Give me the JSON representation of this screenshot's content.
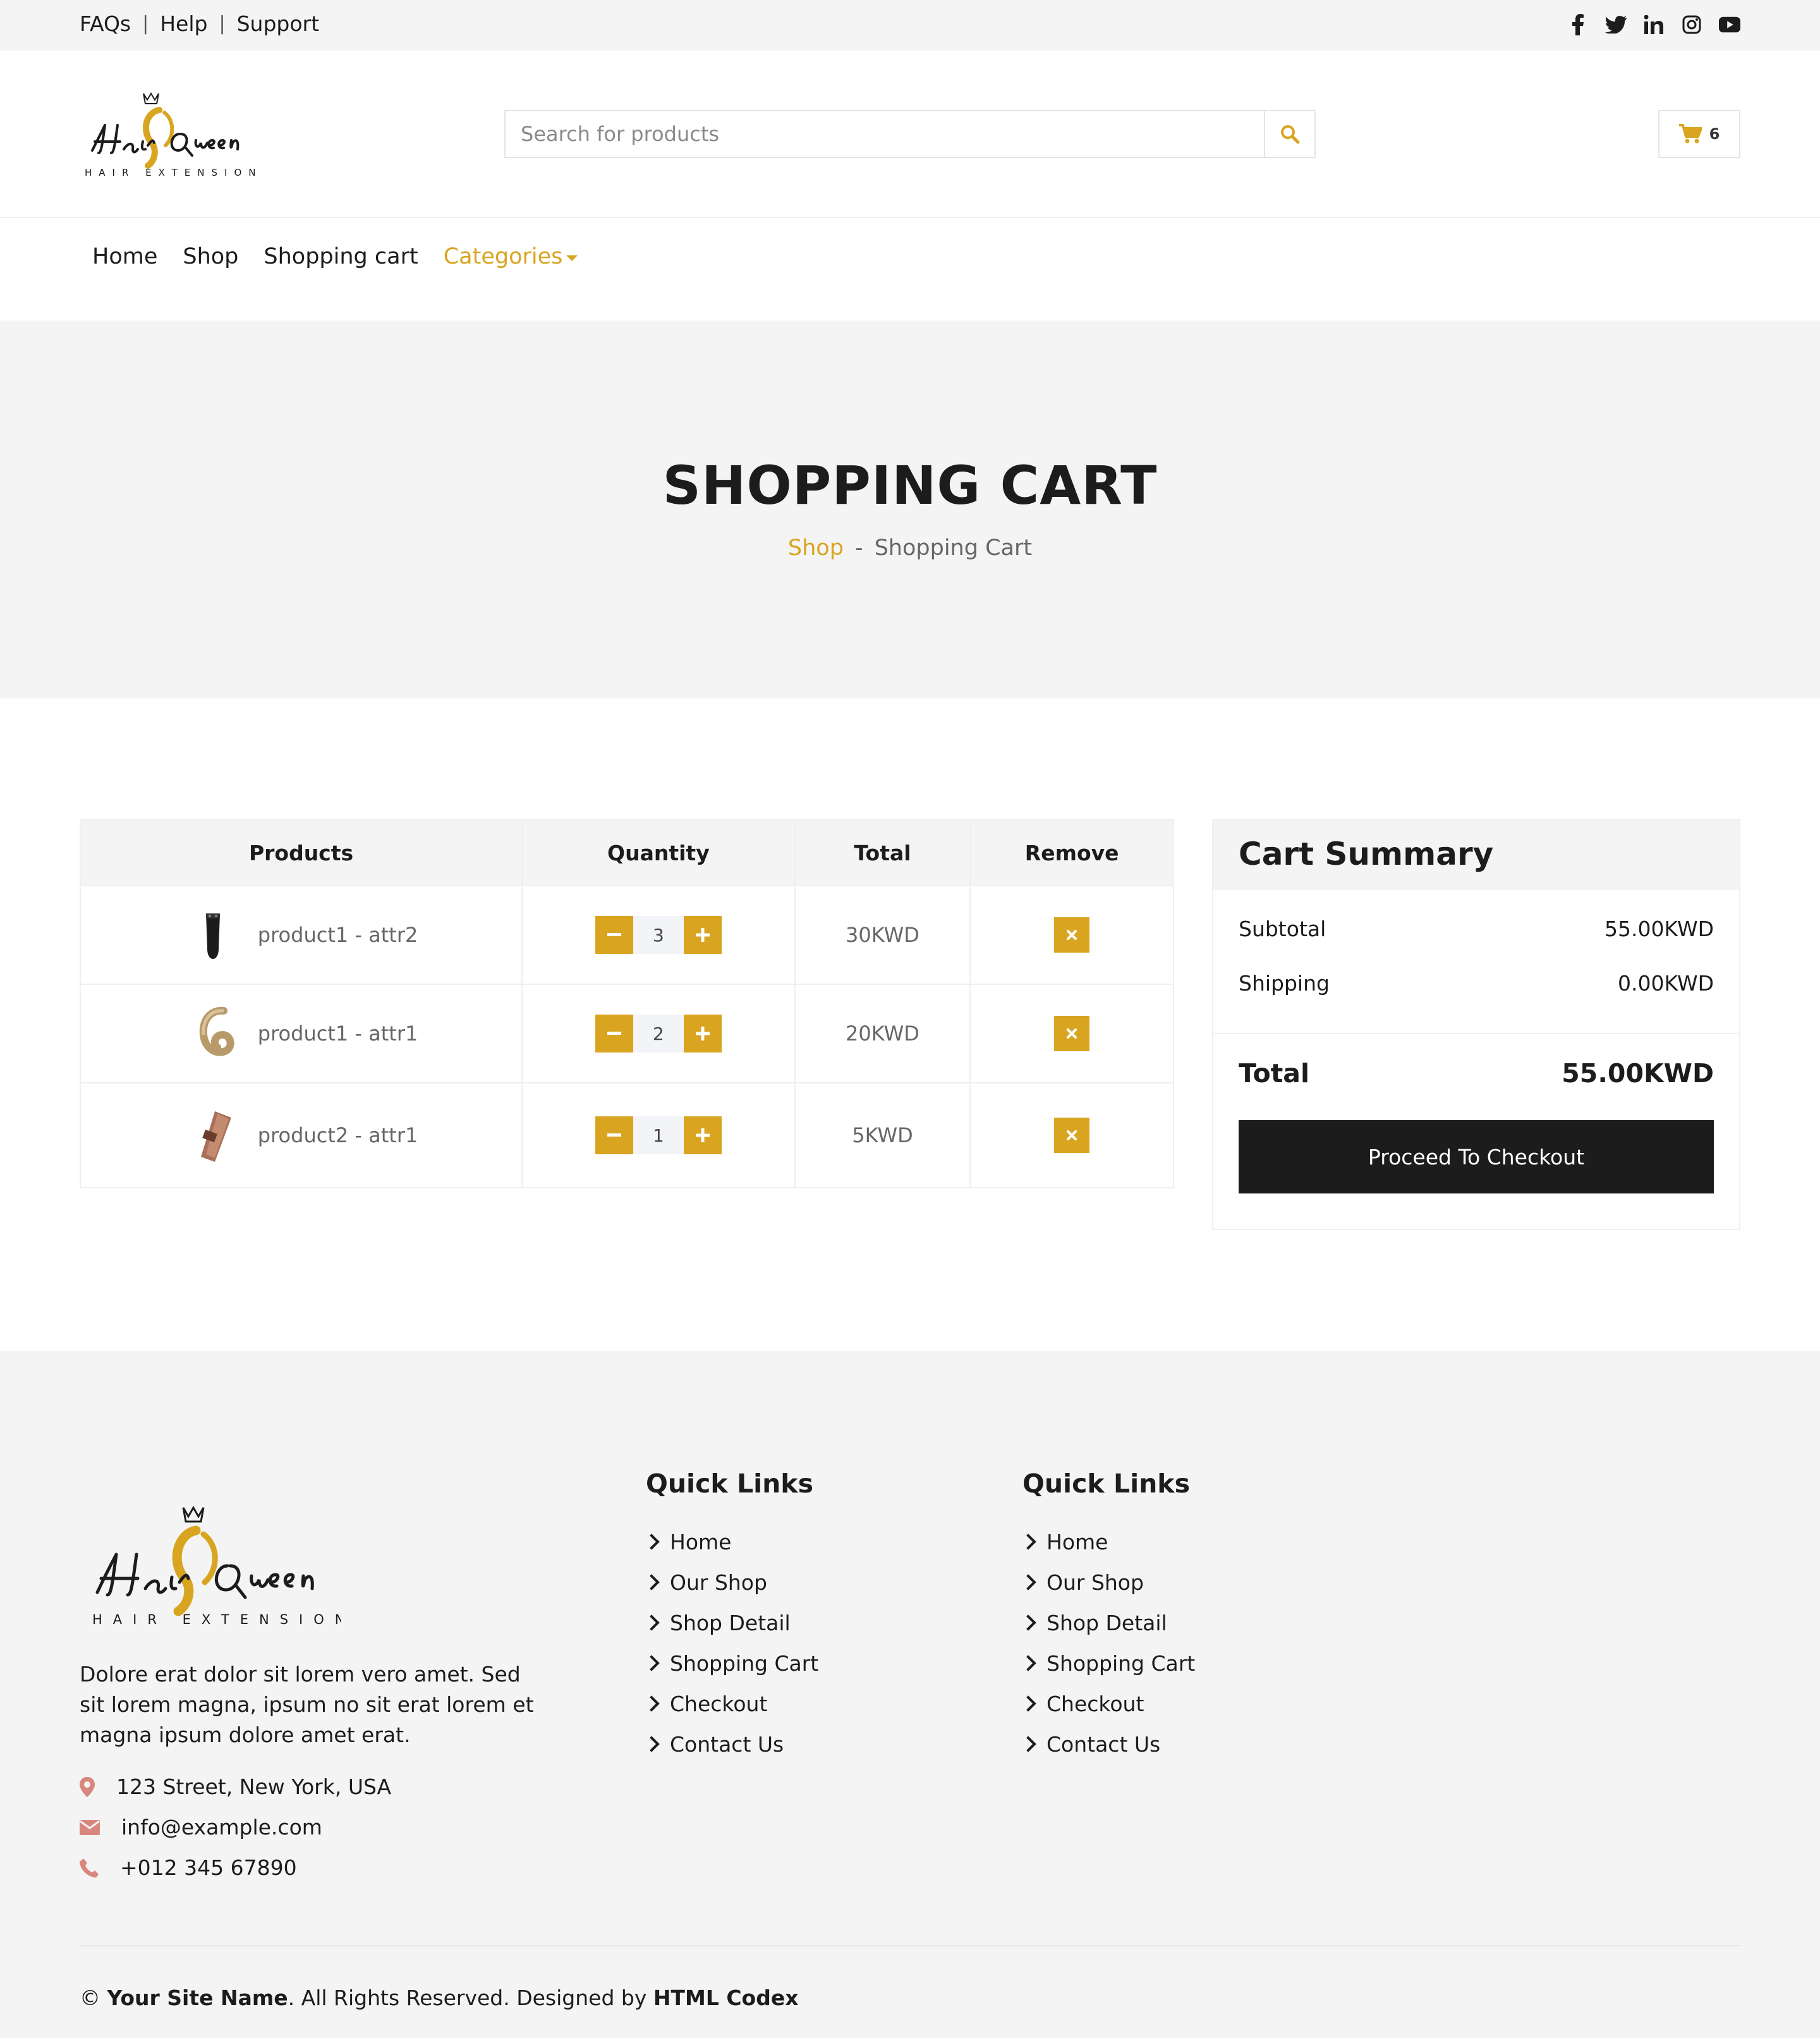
{
  "topbar": {
    "links": [
      "FAQs",
      "Help",
      "Support"
    ],
    "social_icons": [
      "facebook-icon",
      "twitter-icon",
      "linkedin-icon",
      "instagram-icon",
      "youtube-icon"
    ]
  },
  "brand": {
    "logo_script": "Hair Queen",
    "logo_tagline": "HAIR EXTENSIONS",
    "accent_color": "#d9a521",
    "dark_color": "#1c1c1c"
  },
  "search": {
    "placeholder": "Search for products",
    "icon": "search-icon"
  },
  "cart_badge": {
    "icon": "cart-icon",
    "count": "6"
  },
  "nav": {
    "items": [
      "Home",
      "Shop",
      "Shopping cart"
    ],
    "categories_label": "Categories"
  },
  "hero": {
    "title": "SHOPPING CART",
    "breadcrumb_shop": "Shop",
    "breadcrumb_sep": "-",
    "breadcrumb_current": "Shopping Cart"
  },
  "cart": {
    "columns": [
      "Products",
      "Quantity",
      "Total",
      "Remove"
    ],
    "rows": [
      {
        "name": "product1 - attr2",
        "qty": "3",
        "total": "30KWD"
      },
      {
        "name": "product1 - attr1",
        "qty": "2",
        "total": "20KWD"
      },
      {
        "name": "product2 - attr1",
        "qty": "1",
        "total": "5KWD"
      }
    ]
  },
  "summary": {
    "title": "Cart Summary",
    "subtotal_label": "Subtotal",
    "subtotal_value": "55.00KWD",
    "shipping_label": "Shipping",
    "shipping_value": "0.00KWD",
    "total_label": "Total",
    "total_value": "55.00KWD",
    "checkout_label": "Proceed To Checkout"
  },
  "footer": {
    "about": "Dolore erat dolor sit lorem vero amet. Sed sit lorem magna, ipsum no sit erat lorem et magna ipsum dolore amet erat.",
    "address": "123 Street, New York, USA",
    "email": "info@example.com",
    "phone": "+012 345 67890",
    "quick_links_1": {
      "title": "Quick Links",
      "items": [
        "Home",
        "Our Shop",
        "Shop Detail",
        "Shopping Cart",
        "Checkout",
        "Contact Us"
      ]
    },
    "quick_links_2": {
      "title": "Quick Links",
      "items": [
        "Home",
        "Our Shop",
        "Shop Detail",
        "Shopping Cart",
        "Checkout",
        "Contact Us"
      ]
    },
    "copyright_symbol": "©",
    "site_name": "Your Site Name",
    "rights": ". All Rights Reserved. Designed by ",
    "designer": "HTML Codex"
  }
}
